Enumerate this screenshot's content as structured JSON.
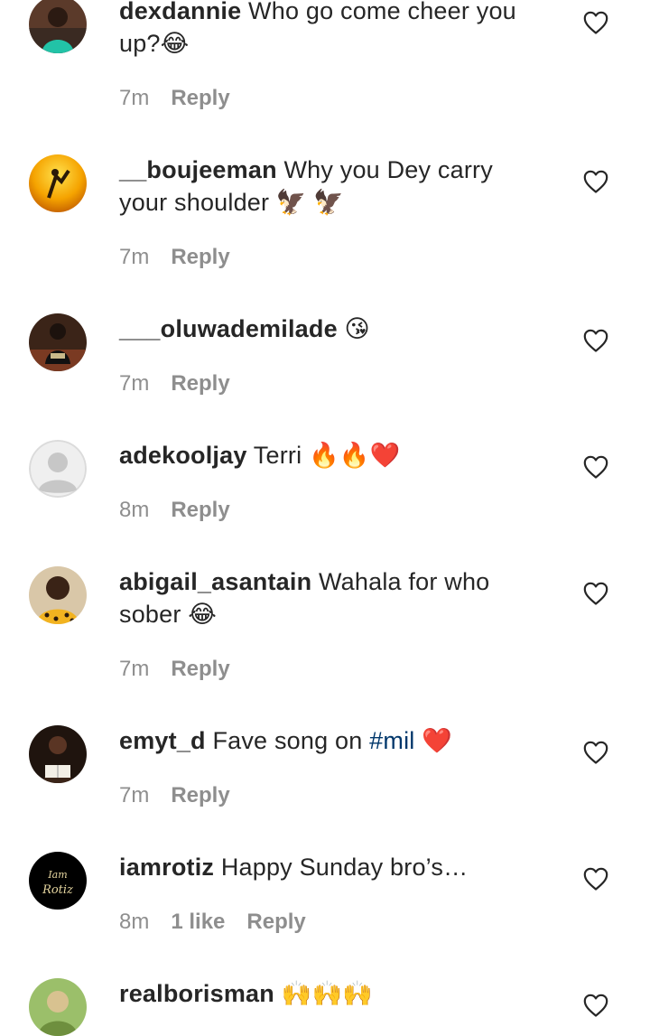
{
  "comments": [
    {
      "username": "dexdannie",
      "text_pre": " Who go come cheer you up?😂",
      "hashtag": "",
      "text_post": "",
      "time": "7m",
      "likes": "",
      "reply": "Reply",
      "avatar": "avatar-green"
    },
    {
      "username": "__boujeeman",
      "text_pre": " Why you Dey carry your shoulder 🦅 🦅",
      "hashtag": "",
      "text_post": "",
      "time": "7m",
      "likes": "",
      "reply": "Reply",
      "avatar": "avatar-orange"
    },
    {
      "username": "___oluwademilade",
      "text_pre": " 😘",
      "hashtag": "",
      "text_post": "",
      "time": "7m",
      "likes": "",
      "reply": "Reply",
      "avatar": "avatar-dark"
    },
    {
      "username": "adekooljay",
      "text_pre": " Terri 🔥🔥❤️",
      "hashtag": "",
      "text_post": "",
      "time": "8m",
      "likes": "",
      "reply": "Reply",
      "avatar": "avatar-default"
    },
    {
      "username": "abigail_asantain",
      "text_pre": " Wahala for who sober 😂",
      "hashtag": "",
      "text_post": "",
      "time": "7m",
      "likes": "",
      "reply": "Reply",
      "avatar": "avatar-yellow"
    },
    {
      "username": "emyt_d",
      "text_pre": " Fave song on ",
      "hashtag": "#mil",
      "text_post": " ❤️",
      "time": "7m",
      "likes": "",
      "reply": "Reply",
      "avatar": "avatar-brown"
    },
    {
      "username": "iamrotiz",
      "text_pre": " Happy Sunday bro’s…",
      "hashtag": "",
      "text_post": "",
      "time": "8m",
      "likes": "1 like",
      "reply": "Reply",
      "avatar": "avatar-logo",
      "avatar_logo_text": "Iam Rotiz"
    },
    {
      "username": "realborisman",
      "text_pre": " 🙌🙌🙌",
      "hashtag": "",
      "text_post": "",
      "time": "",
      "likes": "",
      "reply": "",
      "avatar": "avatar-green-light"
    }
  ],
  "icons": {
    "like": "heart-outline-icon"
  },
  "colors": {
    "text": "#262626",
    "meta": "#8e8e8e",
    "hashtag": "#00376b"
  }
}
